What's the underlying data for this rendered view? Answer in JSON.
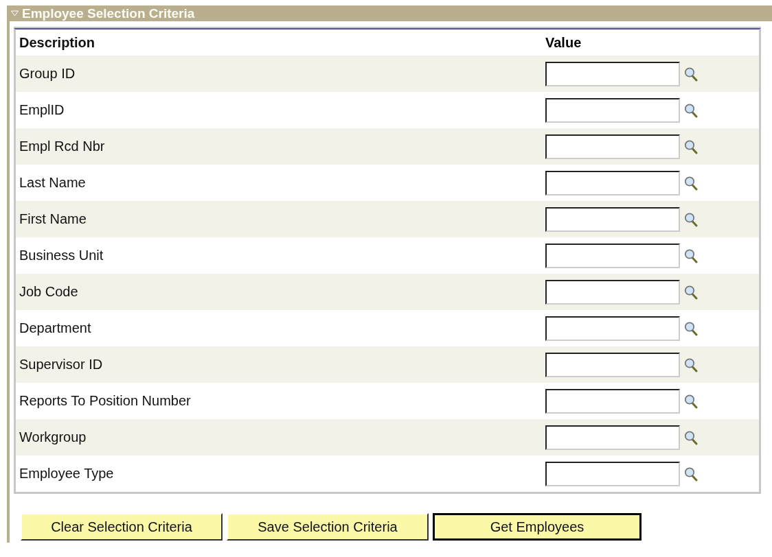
{
  "section": {
    "title": "Employee Selection Criteria",
    "expanded": true
  },
  "table": {
    "columns": [
      "Description",
      "Value"
    ],
    "rows": [
      {
        "description": "Group ID"
      },
      {
        "description": "EmplID"
      },
      {
        "description": "Empl Rcd Nbr"
      },
      {
        "description": "Last Name"
      },
      {
        "description": "First Name"
      },
      {
        "description": "Business Unit"
      },
      {
        "description": "Job Code"
      },
      {
        "description": "Department"
      },
      {
        "description": "Supervisor ID"
      },
      {
        "description": "Reports To Position Number"
      },
      {
        "description": "Workgroup"
      },
      {
        "description": "Employee Type"
      }
    ]
  },
  "buttons": [
    {
      "label": "Clear Selection Criteria",
      "default": false
    },
    {
      "label": "Save Selection Criteria",
      "default": false
    },
    {
      "label": "Get Employees",
      "default": true
    }
  ]
}
